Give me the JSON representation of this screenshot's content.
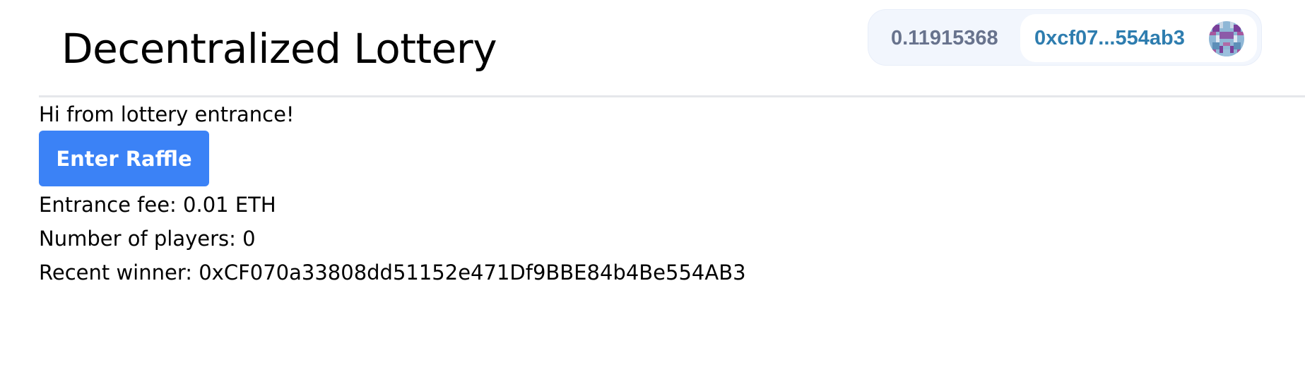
{
  "header": {
    "title": "Decentralized Lottery"
  },
  "wallet": {
    "balance": "0.11915368",
    "address": "0xcf07...554ab3",
    "avatar_icon": "blockie-avatar-icon"
  },
  "main": {
    "greeting": "Hi from lottery entrance!",
    "enter_button_label": "Enter Raffle",
    "entrance_fee_text": "Entrance fee: 0.01 ETH",
    "players_text": "Number of players: 0",
    "recent_winner_text": "Recent winner: 0xCF070a33808dd51152e471Df9BBE84b4Be554AB3"
  },
  "colors": {
    "button_bg": "#3b82f6",
    "wallet_bg": "#f2f6fd",
    "address_color": "#2e7daf",
    "balance_color": "#68738d",
    "divider": "#e5e7eb"
  }
}
